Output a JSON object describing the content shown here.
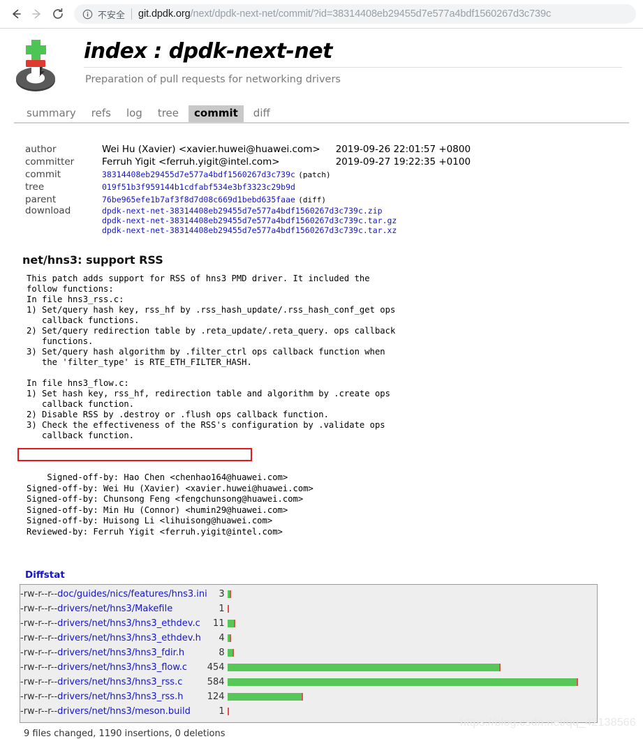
{
  "browser": {
    "back_icon": "arrow-left-icon",
    "forward_icon": "arrow-right-icon",
    "reload_icon": "reload-icon",
    "info_icon": "info-circle-icon",
    "security_label": "不安全",
    "url_host": "git.dpdk.org",
    "url_path": "/next/dpdk-next-net/commit/?id=38314408eb29455d7e577a4bdf1560267d3c739c"
  },
  "header": {
    "logo_name": "cgit-logo",
    "title": "index : dpdk-next-net",
    "description": "Preparation of pull requests for networking drivers"
  },
  "tabs": [
    {
      "label": "summary",
      "active": false
    },
    {
      "label": "refs",
      "active": false
    },
    {
      "label": "log",
      "active": false
    },
    {
      "label": "tree",
      "active": false
    },
    {
      "label": "commit",
      "active": true
    },
    {
      "label": "diff",
      "active": false
    }
  ],
  "commit_info": {
    "author_label": "author",
    "author_value": "Wei Hu (Xavier) <xavier.huwei@huawei.com>",
    "author_date": "2019-09-26 22:01:57 +0800",
    "committer_label": "committer",
    "committer_value": "Ferruh Yigit <ferruh.yigit@intel.com>",
    "committer_date": "2019-09-27 19:22:35 +0100",
    "commit_label": "commit",
    "commit_hash": "38314408eb29455d7e577a4bdf1560267d3c739c",
    "commit_patch_link": "(patch)",
    "tree_label": "tree",
    "tree_hash": "019f51b3f959144b1cdfabf534e3bf3323c29b9d",
    "parent_label": "parent",
    "parent_hash": "76be965efe1b7af3f8d7d08c669d1bebd635faae",
    "parent_diff_link": "(diff)",
    "download_label": "download",
    "downloads": [
      "dpdk-next-net-38314408eb29455d7e577a4bdf1560267d3c739c.zip",
      "dpdk-next-net-38314408eb29455d7e577a4bdf1560267d3c739c.tar.gz",
      "dpdk-next-net-38314408eb29455d7e577a4bdf1560267d3c739c.tar.xz"
    ]
  },
  "commit_message": {
    "subject": "net/hns3: support RSS",
    "body": "This patch adds support for RSS of hns3 PMD driver. It included the\nfollow functions:\nIn file hns3_rss.c:\n1) Set/query hash key, rss_hf by .rss_hash_update/.rss_hash_conf_get ops\n   callback functions.\n2) Set/query redirection table by .reta_update/.reta_query. ops callback\n   functions.\n3) Set/query hash algorithm by .filter_ctrl ops callback function when\n   the 'filter_type' is RTE_ETH_FILTER_HASH.\n\nIn file hns3_flow.c:\n1) Set hash key, rss_hf, redirection table and algorithm by .create ops\n   callback function.\n2) Disable RSS by .destroy or .flush ops callback function.\n3) Check the effectiveness of the RSS's configuration by .validate ops\n   callback function.",
    "trailers": "Signed-off-by: Hao Chen <chenhao164@huawei.com>\nSigned-off-by: Wei Hu (Xavier) <xavier.huwei@huawei.com>\nSigned-off-by: Chunsong Feng <fengchunsong@huawei.com>\nSigned-off-by: Min Hu (Connor) <humin29@huawei.com>\nSigned-off-by: Huisong Li <lihuisong@huawei.com>\nReviewed-by: Ferruh Yigit <ferruh.yigit@intel.com>",
    "highlight_color": "#e8171c"
  },
  "diffstat": {
    "title": "Diffstat",
    "add_color": "#57c75a",
    "del_color": "#d9534f",
    "max_count": 584,
    "rows": [
      {
        "mode": "-rw-r--r--",
        "file": "doc/guides/nics/features/hns3.ini",
        "count": "3",
        "add": 3,
        "del": 0
      },
      {
        "mode": "-rw-r--r--",
        "file": "drivers/net/hns3/Makefile",
        "count": "1",
        "add": 1,
        "del": 0
      },
      {
        "mode": "-rw-r--r--",
        "file": "drivers/net/hns3/hns3_ethdev.c",
        "count": "11",
        "add": 11,
        "del": 0
      },
      {
        "mode": "-rw-r--r--",
        "file": "drivers/net/hns3/hns3_ethdev.h",
        "count": "4",
        "add": 4,
        "del": 0
      },
      {
        "mode": "-rw-r--r--",
        "file": "drivers/net/hns3/hns3_fdir.h",
        "count": "8",
        "add": 8,
        "del": 0
      },
      {
        "mode": "-rw-r--r--",
        "file": "drivers/net/hns3/hns3_flow.c",
        "count": "454",
        "add": 454,
        "del": 0
      },
      {
        "mode": "-rw-r--r--",
        "file": "drivers/net/hns3/hns3_rss.c",
        "count": "584",
        "add": 584,
        "del": 0
      },
      {
        "mode": "-rw-r--r--",
        "file": "drivers/net/hns3/hns3_rss.h",
        "count": "124",
        "add": 124,
        "del": 0
      },
      {
        "mode": "-rw-r--r--",
        "file": "drivers/net/hns3/meson.build",
        "count": "1",
        "add": 1,
        "del": 0
      }
    ],
    "summary": "9 files changed, 1190 insertions, 0 deletions"
  },
  "watermark": "https://blog.csdn.net/qq_42138566"
}
